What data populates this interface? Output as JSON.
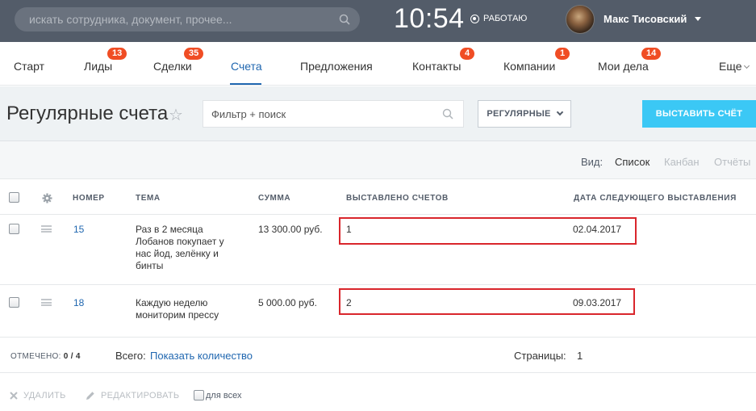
{
  "header": {
    "search_placeholder": "искать сотрудника, документ, прочее...",
    "clock": "10:54",
    "work_status": "РАБОТАЮ",
    "user_name": "Макс Тисовский"
  },
  "nav": {
    "items": [
      {
        "label": "Старт",
        "badge": ""
      },
      {
        "label": "Лиды",
        "badge": "13"
      },
      {
        "label": "Сделки",
        "badge": "35"
      },
      {
        "label": "Счета",
        "badge": "",
        "active": true
      },
      {
        "label": "Предложения",
        "badge": ""
      },
      {
        "label": "Контакты",
        "badge": "4"
      },
      {
        "label": "Компании",
        "badge": "1"
      },
      {
        "label": "Мои дела",
        "badge": "14"
      }
    ],
    "more": "Еще"
  },
  "page": {
    "title": "Регулярные счета",
    "filter_placeholder": "Фильтр + поиск",
    "preset_label": "РЕГУЛЯРНЫЕ",
    "primary_button": "ВЫСТАВИТЬ СЧЁТ"
  },
  "views": {
    "label": "Вид:",
    "list": "Список",
    "kanban": "Канбан",
    "reports": "Отчёты"
  },
  "table": {
    "columns": {
      "number": "НОМЕР",
      "topic": "ТЕМА",
      "sum": "СУММА",
      "issued": "ВЫСТАВЛЕНО СЧЕТОВ",
      "next_date": "ДАТА СЛЕДУЮЩЕГО ВЫСТАВЛЕНИЯ"
    },
    "rows": [
      {
        "number": "15",
        "topic": "Раз в 2 месяца Лобанов покупает у нас йод, зелёнку и бинты",
        "sum": "13 300.00 руб.",
        "issued": "1",
        "next_date": "02.04.2017"
      },
      {
        "number": "18",
        "topic": "Каждую неделю мониторим прессу",
        "sum": "5 000.00 руб.",
        "issued": "2",
        "next_date": "09.03.2017"
      }
    ]
  },
  "footer": {
    "checked_label": "ОТМЕЧЕНО:",
    "checked_value": "0 / 4",
    "total_label": "Всего:",
    "total_link": "Показать количество",
    "pages_label": "Страницы:",
    "pages_value": "1"
  },
  "actions": {
    "delete": "УДАЛИТЬ",
    "edit": "РЕДАКТИРОВАТЬ",
    "for_all": "для всех"
  },
  "colors": {
    "topbar": "#535c69",
    "accent_blue": "#2067b0",
    "badge": "#f04d24",
    "primary_button": "#3bc8f5",
    "highlight": "#d9262c"
  }
}
